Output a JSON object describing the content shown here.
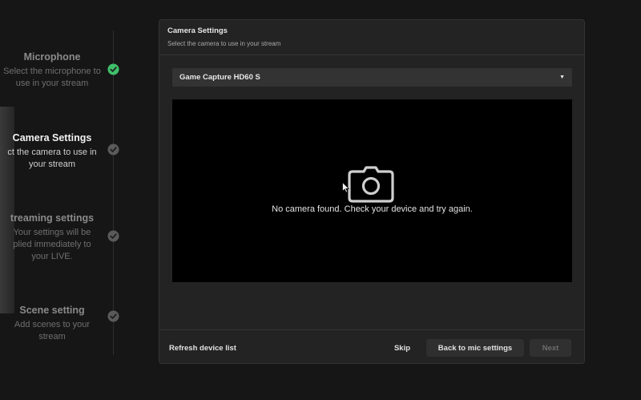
{
  "stepper": {
    "steps": [
      {
        "title": "Microphone",
        "desc_lines": [
          "Select the microphone to",
          "use in your stream"
        ],
        "status": "done"
      },
      {
        "title": "Camera Settings",
        "desc_lines": [
          "ct the camera to use in",
          "your stream"
        ],
        "status": "current"
      },
      {
        "title": "treaming settings",
        "desc_lines": [
          "Your settings will be",
          "plied immediately to",
          "your LIVE."
        ],
        "status": "pending"
      },
      {
        "title": "Scene setting",
        "desc_lines": [
          "Add scenes to your stream"
        ],
        "status": "pending"
      }
    ],
    "done_color": "#3fbf6a",
    "pending_color": "#5a5a5a"
  },
  "dialog": {
    "title": "Camera Settings",
    "subtitle": "Select the camera to use in your stream",
    "camera_select": {
      "value": "Game Capture HD60 S",
      "caret": "▼"
    },
    "preview": {
      "message": "No camera found. Check your device and try again."
    },
    "footer": {
      "refresh_label": "Refresh device list",
      "skip_label": "Skip",
      "back_label": "Back to mic settings",
      "next_label": "Next"
    }
  }
}
